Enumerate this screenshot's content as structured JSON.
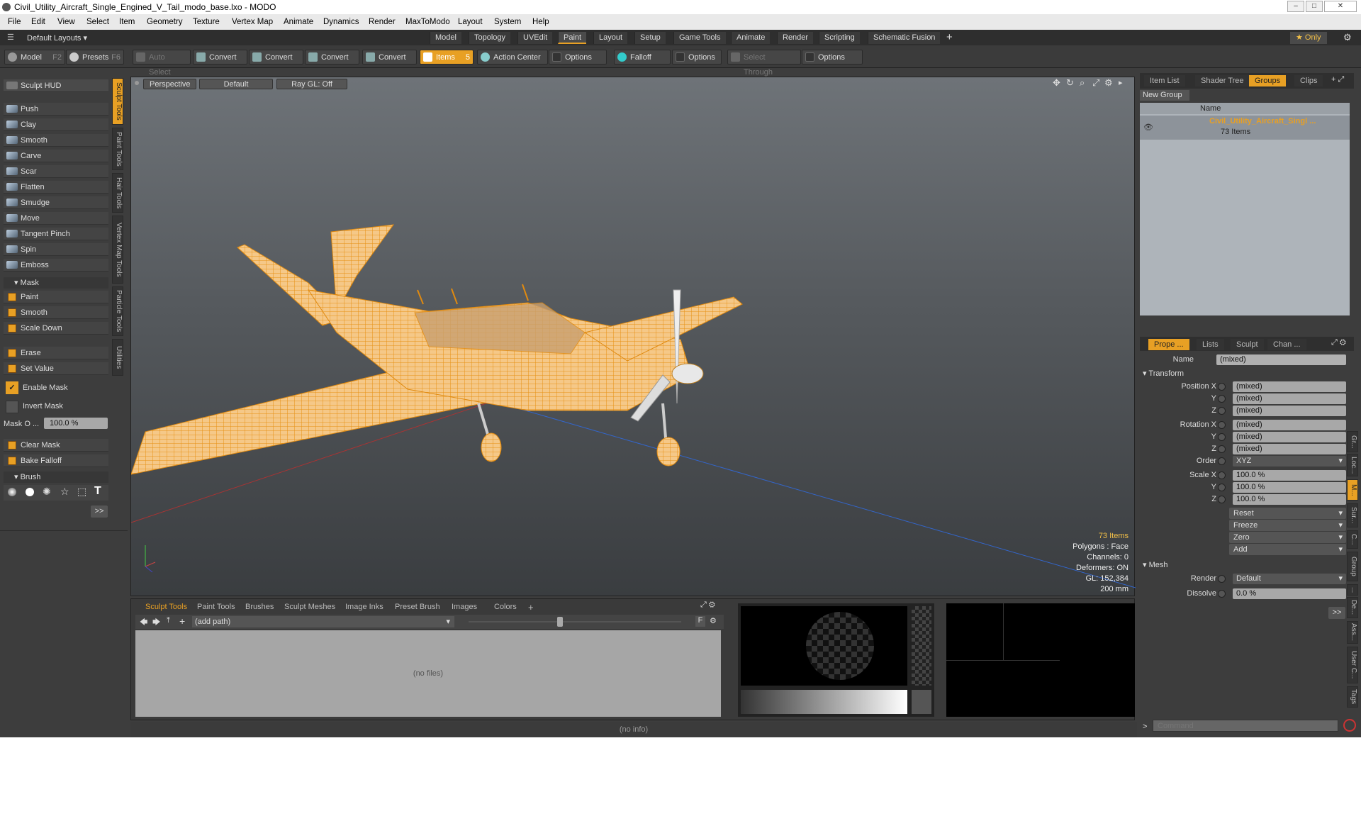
{
  "window": {
    "title": "Civil_Utility_Aircraft_Single_Engined_V_Tail_modo_base.lxo - MODO"
  },
  "menu": [
    "File",
    "Edit",
    "View",
    "Select",
    "Item",
    "Geometry",
    "Texture",
    "Vertex Map",
    "Animate",
    "Dynamics",
    "Render",
    "MaxToModo",
    "Layout",
    "System",
    "Help"
  ],
  "layoutbar": {
    "layouts_label": "Default Layouts ▾",
    "tabs": [
      "Model",
      "Topology",
      "UVEdit",
      "Paint",
      "Layout",
      "Setup",
      "Game Tools",
      "Animate",
      "Render",
      "Scripting",
      "Schematic Fusion"
    ],
    "active_tab": "Paint",
    "plus": "+",
    "only_label": "★  Only"
  },
  "toolbar": {
    "model": "Model",
    "model_key": "F2",
    "presets": "Presets",
    "presets_key": "F6",
    "auto_select": "Auto Select",
    "convert": "Convert",
    "items": "Items",
    "items_key": "5",
    "action_center": "Action Center",
    "options": "Options",
    "falloff": "Falloff",
    "select_through": "Select Through"
  },
  "sculpt": {
    "hud": "Sculpt HUD",
    "tools": [
      "Push",
      "Clay",
      "Smooth",
      "Carve",
      "Scar",
      "Flatten",
      "Smudge",
      "Move",
      "Tangent Pinch",
      "Spin",
      "Emboss"
    ],
    "mask_section": "Mask",
    "mask_tools": [
      "Paint",
      "Smooth",
      "Scale Down"
    ],
    "erase": "Erase",
    "set_value": "Set Value",
    "enable_mask": "Enable Mask",
    "invert_mask": "Invert Mask",
    "mask_opacity_label": "Mask O ...",
    "mask_opacity_value": "100.0 %",
    "clear_mask": "Clear Mask",
    "bake_falloff": "Bake Falloff",
    "brush_section": "Brush",
    "more": ">>"
  },
  "vtabs": [
    "Sculpt Tools",
    "Paint Tools",
    "Hair Tools",
    "Vertex Map Tools",
    "Particle Tools",
    "Utilities"
  ],
  "viewport": {
    "view": "Perspective",
    "shading": "Default",
    "raygl": "Ray GL: Off",
    "stats": {
      "items": "73 Items",
      "polygons": "Polygons : Face",
      "channels": "Channels: 0",
      "deformers": "Deformers: ON",
      "gl": "GL: 152,384",
      "scale": "200 mm"
    }
  },
  "bottom": {
    "tabs": [
      "Sculpt Tools",
      "Paint Tools",
      "Brushes",
      "Sculpt Meshes",
      "Image Inks",
      "Preset Brush",
      "Images",
      "Colors"
    ],
    "plus": "+",
    "path": "(add path)",
    "no_files": "(no files)",
    "f_label": "F"
  },
  "status": {
    "info": "(no info)"
  },
  "groups_panel": {
    "tabs": [
      "Item List",
      "Shader Tree",
      "Groups",
      "Clips"
    ],
    "active_tab": "Groups",
    "new_group": "New Group",
    "column_name": "Name",
    "group_name": "Civil_Utility_Aircraft_Singl ...",
    "group_count": "73 Items"
  },
  "properties": {
    "tabs": [
      "Prope ...",
      "Lists",
      "Sculpt",
      "Chan ..."
    ],
    "active_tab": "Prope ...",
    "name_label": "Name",
    "name_value": "(mixed)",
    "transform": "Transform",
    "position_x": "Position X",
    "y": "Y",
    "z": "Z",
    "rotation_x": "Rotation X",
    "order_label": "Order",
    "order_value": "XYZ",
    "scale_x": "Scale X",
    "mixed": "(mixed)",
    "scale_value": "100.0 %",
    "actions": [
      "Reset",
      "Freeze",
      "Zero",
      "Add"
    ],
    "mesh": "Mesh",
    "render_label": "Render",
    "render_value": "Default",
    "dissolve_label": "Dissolve",
    "dissolve_value": "0.0 %",
    "more": ">>"
  },
  "side_tabs": [
    "Gr...",
    "Loc...",
    "M...",
    "Sur...",
    "C...",
    "Group",
    "...",
    "De...",
    "Ass...",
    "User C...",
    "Tags"
  ],
  "command": {
    "placeholder": "Command",
    "prompt": ">"
  },
  "colors": {
    "accent": "#e8a024",
    "wire": "#f0a020"
  }
}
